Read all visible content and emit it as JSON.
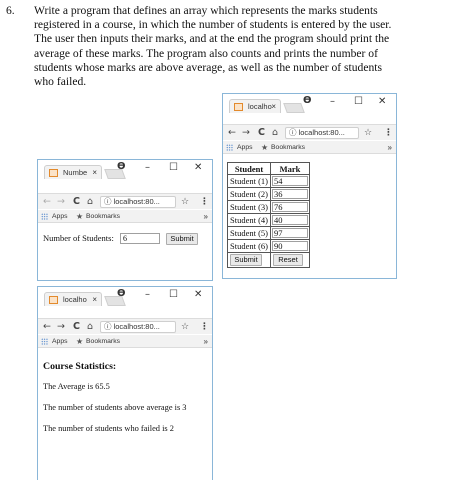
{
  "question": {
    "number": "6.",
    "lines": [
      "Write a program that defines an array which represents the marks students",
      "registered in a course, in which the number of students is entered by the user.",
      "The user then inputs their marks, and at the end the program should print the",
      "average of these marks. The program also counts and prints the number of",
      "students whose marks are above average, as well as the number of students",
      "who failed."
    ]
  },
  "browser": {
    "profile_icon": "profile-icon",
    "min": "–",
    "max": "☐",
    "close": "✕",
    "back": "←",
    "forward": "→",
    "reload": "C",
    "home": "⌂",
    "star": "☆",
    "menu": "⋮",
    "info": "ⓘ",
    "apps": "Apps",
    "bookmarks": "Bookmarks",
    "chevron": "»",
    "tab_close": "×"
  },
  "window1": {
    "tab_title": "Numbe",
    "url": "localhost:80...",
    "field_label": "Number of Students:",
    "field_value": "6",
    "submit_label": "Submit"
  },
  "window2": {
    "tab_title": "localho",
    "url": "localhost:80...",
    "headers": [
      "Student",
      "Mark"
    ],
    "rows": [
      {
        "student": "Student (1)",
        "mark": "54"
      },
      {
        "student": "Student (2)",
        "mark": "36"
      },
      {
        "student": "Student (3)",
        "mark": "76"
      },
      {
        "student": "Student (4)",
        "mark": "40"
      },
      {
        "student": "Student (5)",
        "mark": "97"
      },
      {
        "student": "Student (6)",
        "mark": "90"
      }
    ],
    "submit_label": "Submit",
    "reset_label": "Reset"
  },
  "window3": {
    "tab_title": "localho",
    "url": "localhost:80...",
    "title": "Course Statistics:",
    "average": "The Average is 65.5",
    "above_average": "The number of students above average is 3",
    "failed": "The number of students who failed is 2"
  }
}
